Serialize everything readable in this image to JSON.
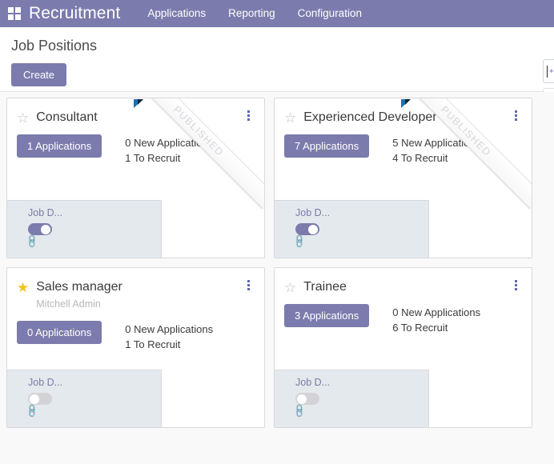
{
  "navbar": {
    "apps_icon": "apps-grid-icon",
    "brand": "Recruitment",
    "menu": [
      {
        "label": "Applications"
      },
      {
        "label": "Reporting"
      },
      {
        "label": "Configuration"
      }
    ]
  },
  "control_panel": {
    "title": "Job Positions",
    "create_label": "Create",
    "search_value": "",
    "search_placeholder": ""
  },
  "kanban": {
    "ribbon_label": "PUBLISHED",
    "kebab_icon": "vertical-dots-icon",
    "star_icon": "star-icon",
    "link_icon": "link-icon",
    "footer_label": "Job D...",
    "cards": [
      {
        "title": "Consultant",
        "manager": "",
        "favorite": false,
        "published": true,
        "applications_label": "1 Applications",
        "new_applications": "0 New Applications",
        "to_recruit": "1 To Recruit",
        "website_published": true
      },
      {
        "title": "Experienced Developer",
        "manager": "",
        "favorite": false,
        "published": true,
        "applications_label": "7 Applications",
        "new_applications": "5 New Applications",
        "to_recruit": "4 To Recruit",
        "website_published": true
      },
      {
        "title": "Sales manager",
        "manager": "Mitchell Admin",
        "favorite": true,
        "published": false,
        "applications_label": "0 Applications",
        "new_applications": "0 New Applications",
        "to_recruit": "1 To Recruit",
        "website_published": false
      },
      {
        "title": "Trainee",
        "manager": "",
        "favorite": false,
        "published": false,
        "applications_label": "3 Applications",
        "new_applications": "0 New Applications",
        "to_recruit": "6 To Recruit",
        "website_published": false
      }
    ]
  },
  "colors": {
    "brand_purple": "#7c7bad",
    "page_bg": "#f9f9f9",
    "card_footer": "#e4e9ed",
    "star_active": "#f0c419",
    "ribbon_flag": "#1675b5"
  }
}
